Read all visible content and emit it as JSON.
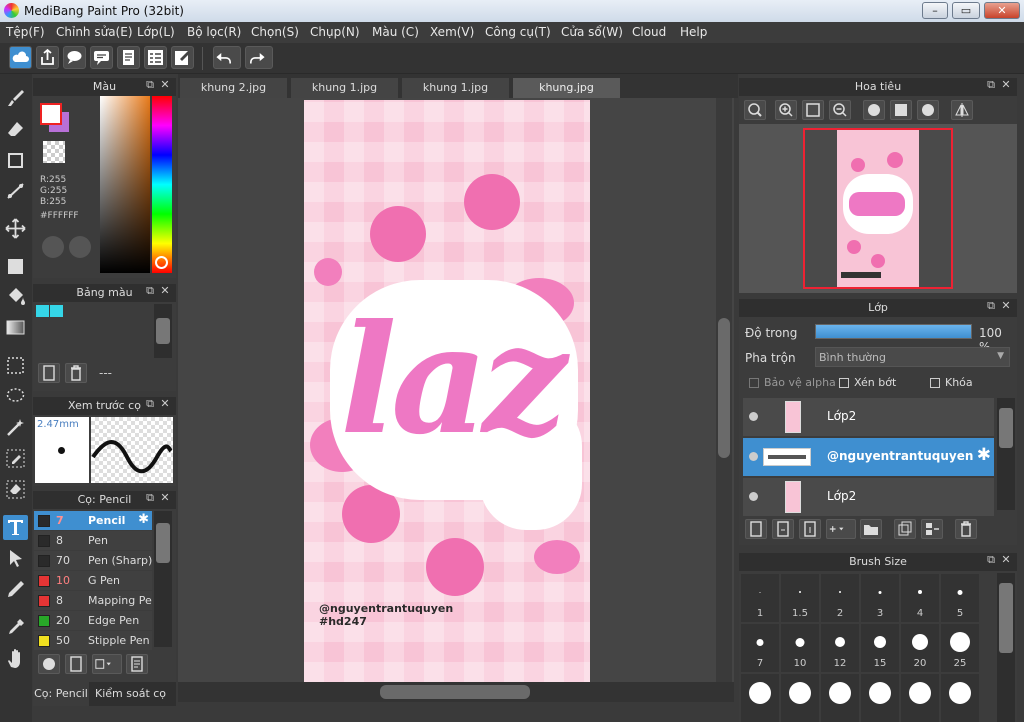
{
  "window": {
    "title": "MediBang Paint Pro (32bit)",
    "minimize": "–",
    "maximize": "▭",
    "close": "✕"
  },
  "menu": [
    "Tệp(F)",
    "Chỉnh sửa(E)",
    "Lớp(L)",
    "Bộ lọc(R)",
    "Chọn(S)",
    "Chụp(N)",
    "Màu (C)",
    "Xem(V)",
    "Công cụ(T)",
    "Cửa sổ(W)",
    "Cloud",
    "Help"
  ],
  "toolbar_icons": [
    "cloud-icon",
    "share-icon",
    "comment-icon",
    "speech-balloon-icon",
    "page-icon",
    "page-manager-icon",
    "edit-icon",
    "undo-icon",
    "redo-icon"
  ],
  "tools": [
    "brush-icon",
    "eraser-icon",
    "rectangle-icon",
    "dot-line-icon",
    "move-icon",
    "fill-rect-icon",
    "bucket-icon",
    "gradient-icon",
    "select-rect-icon",
    "lasso-icon",
    "magic-wand-icon",
    "select-pen-icon",
    "select-eraser-icon",
    "text-icon",
    "operation-icon",
    "divide-icon",
    "eyedropper-icon",
    "hand-icon"
  ],
  "color_panel": {
    "title": "Màu",
    "r": "R:255",
    "g": "G:255",
    "b": "B:255",
    "hex": "#FFFFFF",
    "primary": "#FFFFFF",
    "secondary": "#B870D8"
  },
  "palette_panel": {
    "title": "Bảng màu",
    "swatches": [
      "#35D6E8",
      "#35D6E8"
    ],
    "empty_label": "---"
  },
  "preview_panel": {
    "title": "Xem trước cọ",
    "size": "2.47mm"
  },
  "brush_panel": {
    "title": "Cọ: Pencil",
    "brushes": [
      {
        "size": "7",
        "name": "Pencil",
        "color": "#2a2a2a",
        "selected": true,
        "sizeColor": "#ff8080"
      },
      {
        "size": "8",
        "name": "Pen",
        "color": "#2a2a2a",
        "selected": false,
        "sizeColor": "#dddddd"
      },
      {
        "size": "70",
        "name": "Pen (Sharp)",
        "color": "#2a2a2a",
        "selected": false,
        "sizeColor": "#dddddd"
      },
      {
        "size": "10",
        "name": "G Pen",
        "color": "#e53535",
        "selected": false,
        "sizeColor": "#ff8080"
      },
      {
        "size": "8",
        "name": "Mapping Pen",
        "color": "#e53535",
        "selected": false,
        "sizeColor": "#dddddd"
      },
      {
        "size": "20",
        "name": "Edge Pen",
        "color": "#28a828",
        "selected": false,
        "sizeColor": "#dddddd"
      },
      {
        "size": "50",
        "name": "Stipple Pen",
        "color": "#f0e020",
        "selected": false,
        "sizeColor": "#dddddd"
      }
    ],
    "bottom_tabs": [
      "Cọ: Pencil",
      "Kiểm soát cọ"
    ]
  },
  "tabs": [
    {
      "label": "khung 2.jpg",
      "active": false
    },
    {
      "label": "khung 1.jpg",
      "active": false
    },
    {
      "label": "khung 1.jpg",
      "active": false
    },
    {
      "label": "khung.jpg",
      "active": true
    }
  ],
  "artwork": {
    "lettering": "laz",
    "credit": "@nguyentrantuquyen",
    "hashtag": "#hd247"
  },
  "navigator": {
    "title": "Hoa tiêu"
  },
  "layers": {
    "title": "Lớp",
    "opacity_label": "Độ trong",
    "opacity_value": "100 %",
    "opacity": 1.0,
    "blend_label": "Pha trộn",
    "blend_value": "Bình thường",
    "protect_alpha": "Bảo vệ alpha",
    "clipping": "Xén bớt",
    "lock": "Khóa",
    "rows": [
      {
        "name": "Lớp2",
        "selected": false
      },
      {
        "name": "@nguyentrantuquyen",
        "selected": true
      },
      {
        "name": "Lớp2",
        "selected": false
      }
    ]
  },
  "brush_size": {
    "title": "Brush Size",
    "sizes": [
      "1",
      "1.5",
      "2",
      "3",
      "4",
      "5",
      "7",
      "10",
      "12",
      "15",
      "20",
      "25",
      "",
      "",
      "",
      "",
      "",
      ""
    ]
  }
}
